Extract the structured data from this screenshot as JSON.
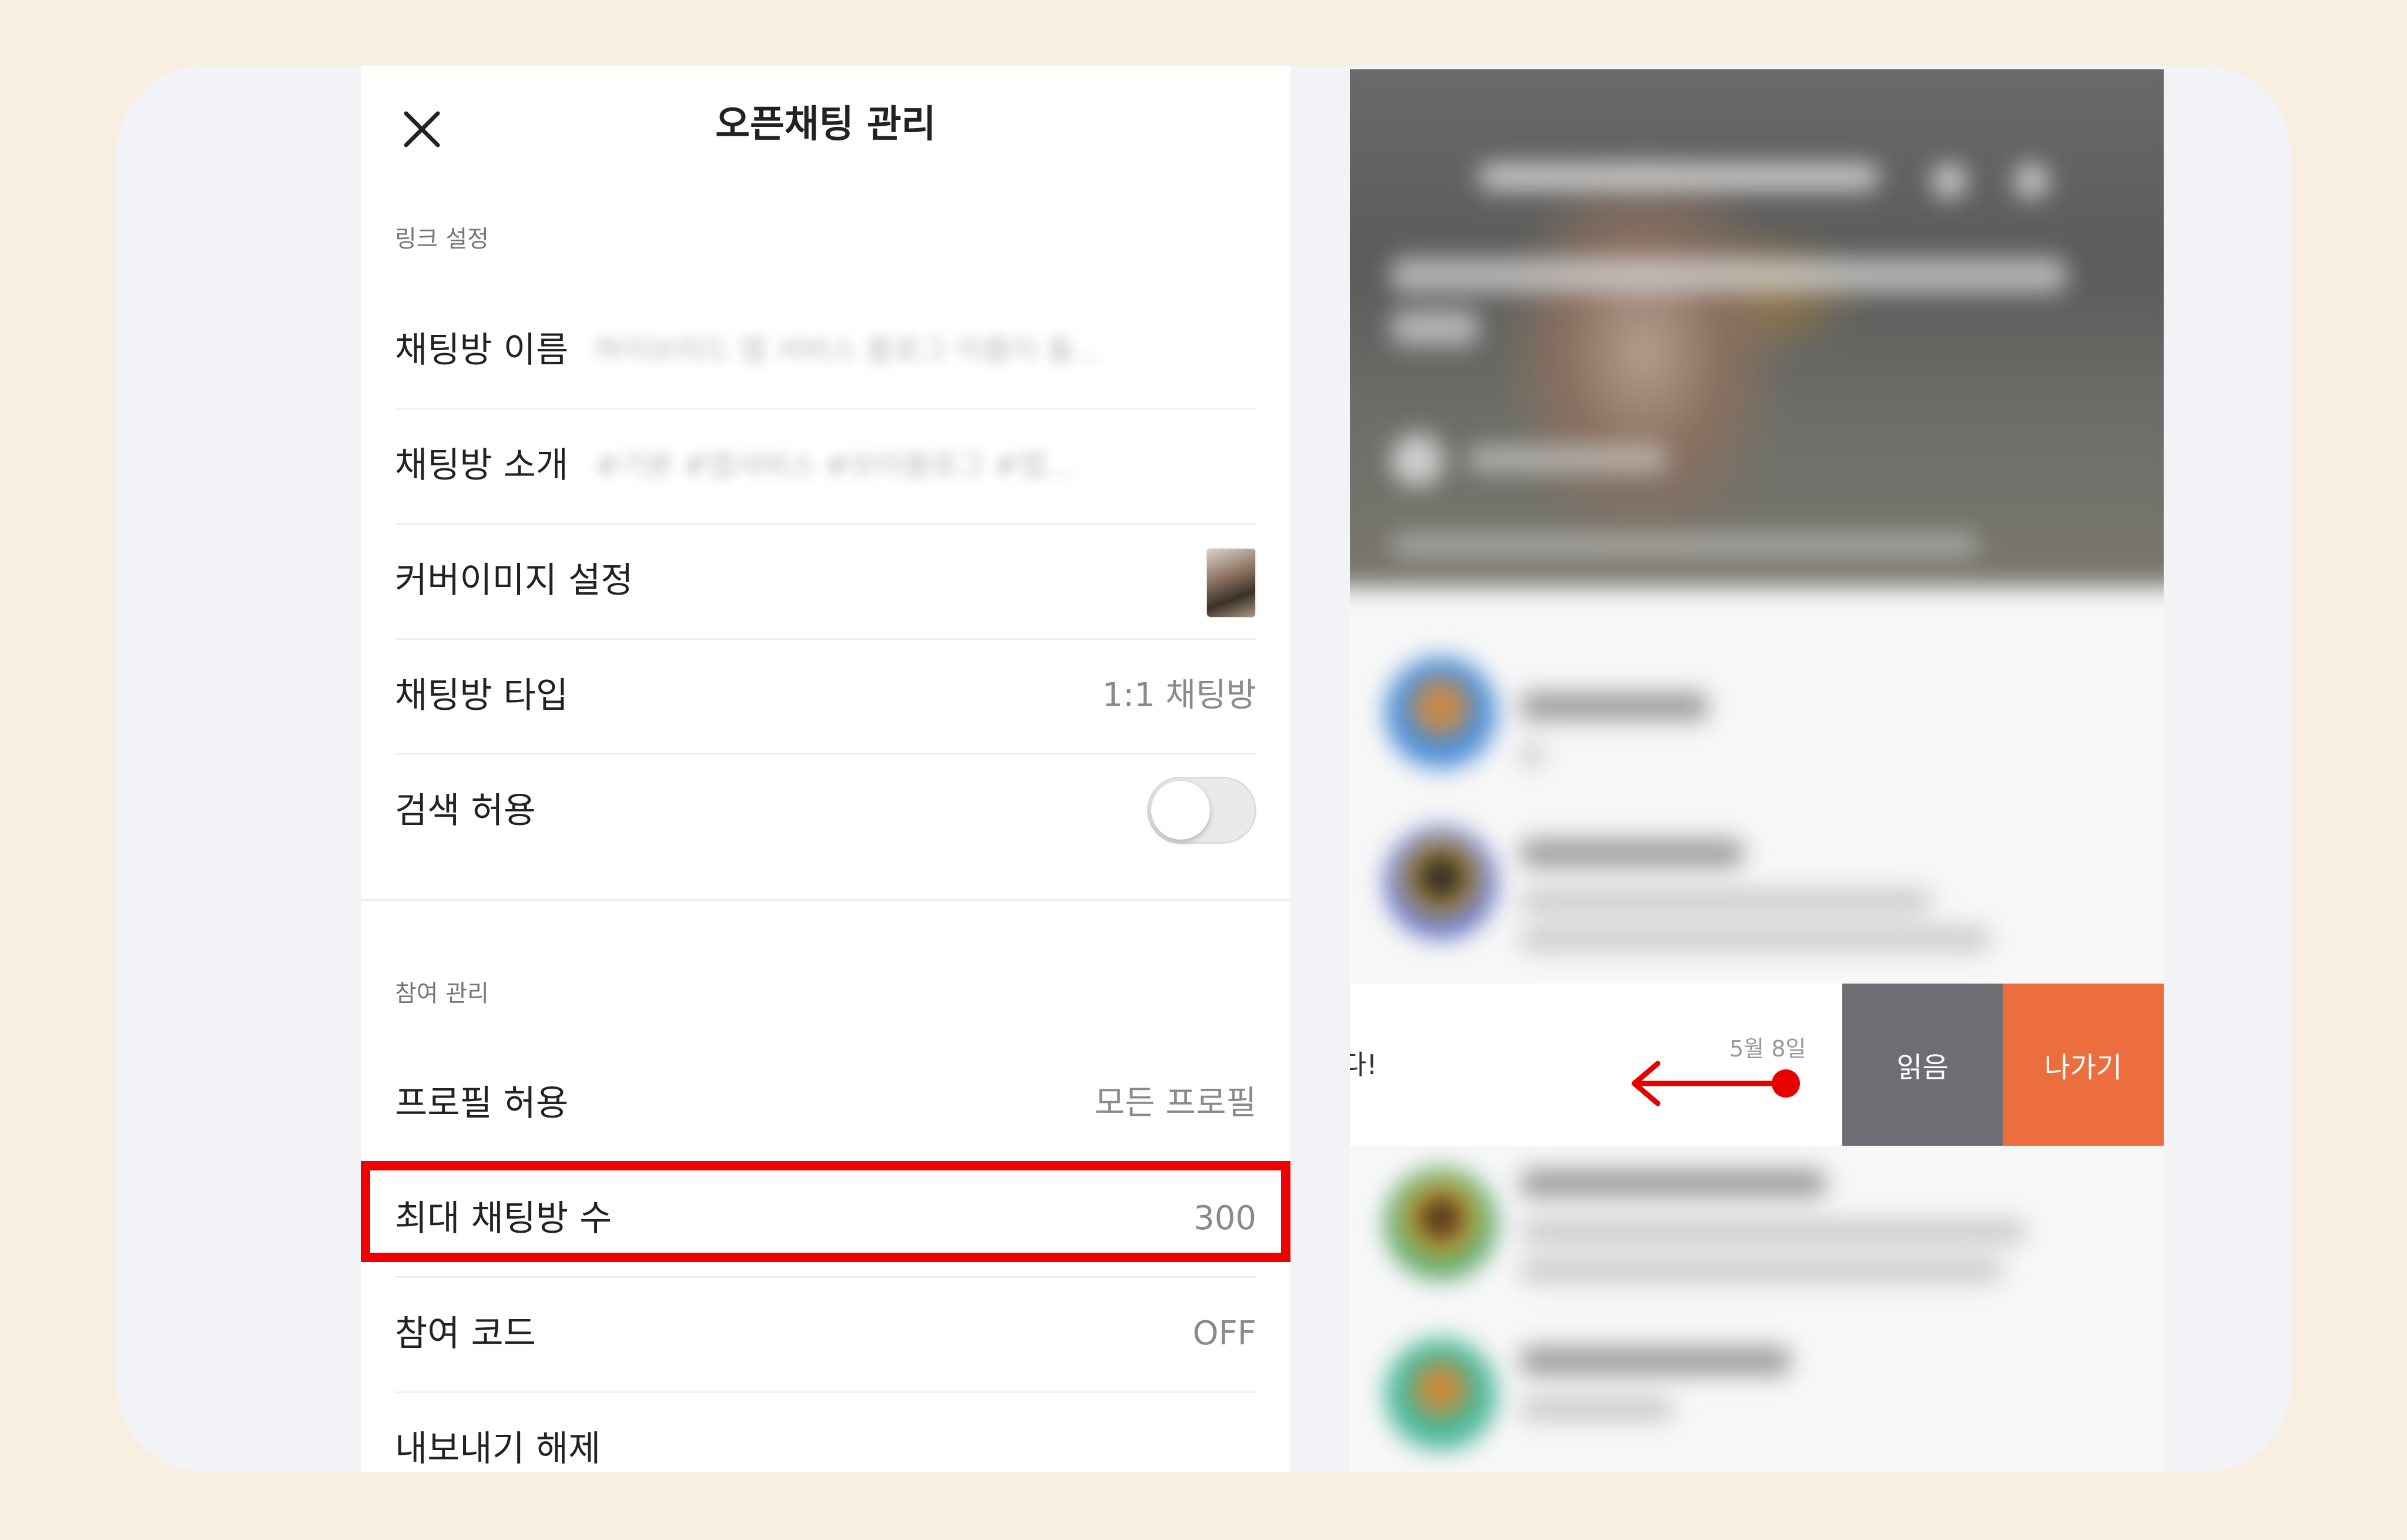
{
  "header": {
    "title": "오픈채팅 관리",
    "close_icon": "close-icon"
  },
  "link_settings": {
    "section_label": "링크 설정",
    "rows": [
      {
        "label": "채팅방 이름",
        "value": "하이브리드 앱 서비스 블로그 이름이 들..."
      },
      {
        "label": "채팅방 소개",
        "value": "#기본 #앱서비스 #브이블로그 #앱..."
      },
      {
        "label": "커버이미지 설정",
        "value": ""
      },
      {
        "label": "채팅방 타입",
        "value": "1:1 채팅방"
      },
      {
        "label": "검색 허용",
        "value": ""
      }
    ]
  },
  "participation": {
    "section_label": "참여 관리",
    "rows": [
      {
        "label": "프로필 허용",
        "value": "모든 프로필"
      },
      {
        "label": "최대 채팅방 수",
        "value": "300"
      },
      {
        "label": "참여 코드",
        "value": "OFF"
      },
      {
        "label": "내보내기 해제",
        "value": ""
      }
    ]
  },
  "toggle": {
    "search_allowed": false
  },
  "chat_list": {
    "swipe_row": {
      "text": "다!",
      "date": "5월 8일",
      "read_label": "읽음",
      "leave_label": "나가기"
    }
  },
  "colors": {
    "highlight": "#ee0000",
    "leave": "#ec6d3e",
    "read": "#6c6e73",
    "arrow": "#e60000"
  }
}
